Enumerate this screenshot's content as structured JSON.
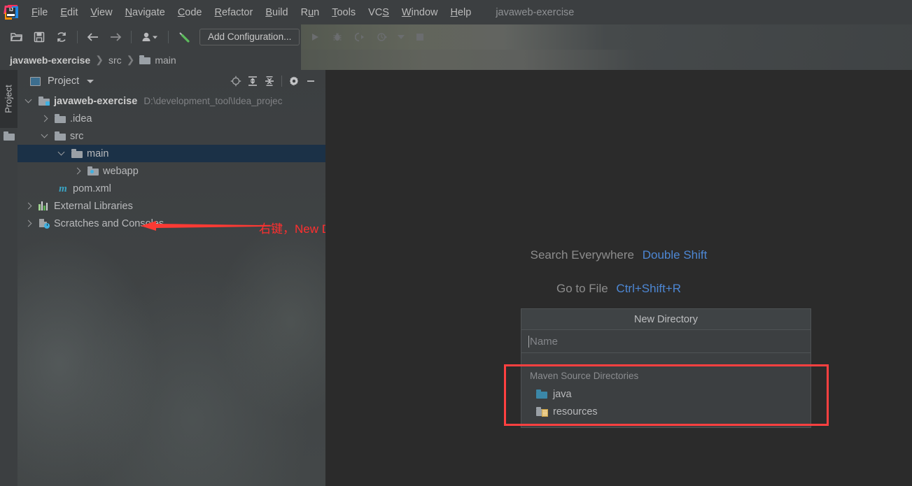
{
  "window": {
    "project_title": "javaweb-exercise"
  },
  "menubar": {
    "items": [
      {
        "label": "File",
        "mnemonic": "F"
      },
      {
        "label": "Edit",
        "mnemonic": "E"
      },
      {
        "label": "View",
        "mnemonic": "V"
      },
      {
        "label": "Navigate",
        "mnemonic": "N"
      },
      {
        "label": "Code",
        "mnemonic": "C"
      },
      {
        "label": "Refactor",
        "mnemonic": "R"
      },
      {
        "label": "Build",
        "mnemonic": "B"
      },
      {
        "label": "Run",
        "mnemonic": "u"
      },
      {
        "label": "Tools",
        "mnemonic": "T"
      },
      {
        "label": "VCS",
        "mnemonic": "S"
      },
      {
        "label": "Window",
        "mnemonic": "W"
      },
      {
        "label": "Help",
        "mnemonic": "H"
      }
    ]
  },
  "toolbar": {
    "add_configuration": "Add Configuration...",
    "icons": [
      "open-folder-icon",
      "save-all-icon",
      "sync-refresh-icon",
      "back-arrow-icon",
      "forward-arrow-icon",
      "user-dropdown-icon",
      "build-hammer-icon",
      "run-icon",
      "debug-icon",
      "run-coverage-icon",
      "profiler-icon",
      "dropdown-caret-icon",
      "stop-icon"
    ]
  },
  "breadcrumb": {
    "root": "javaweb-exercise",
    "parts": [
      "src",
      "main"
    ]
  },
  "left_strip": {
    "project_tab_label": "Project"
  },
  "project_panel": {
    "title": "Project",
    "tool_icons": [
      "locate-target-icon",
      "expand-all-icon",
      "collapse-all-icon",
      "settings-gear-icon",
      "hide-minimize-icon"
    ],
    "tree": [
      {
        "label": "javaweb-exercise",
        "path": "D:\\development_tool\\Idea_projec",
        "icon": "module-folder-icon",
        "indent": 0,
        "expanded": true,
        "bold": true,
        "selected": false
      },
      {
        "label": ".idea",
        "path": "",
        "icon": "folder-icon",
        "indent": 1,
        "expanded": false,
        "bold": false,
        "selected": false
      },
      {
        "label": "src",
        "path": "",
        "icon": "folder-icon",
        "indent": 1,
        "expanded": true,
        "bold": false,
        "selected": false
      },
      {
        "label": "main",
        "path": "",
        "icon": "folder-icon",
        "indent": 2,
        "expanded": true,
        "bold": false,
        "selected": true
      },
      {
        "label": "webapp",
        "path": "",
        "icon": "webapp-folder-icon",
        "indent": 3,
        "expanded": false,
        "bold": false,
        "selected": false
      },
      {
        "label": "pom.xml",
        "path": "",
        "icon": "maven-m-icon",
        "indent": 2,
        "expanded": null,
        "bold": false,
        "selected": false
      },
      {
        "label": "External Libraries",
        "path": "",
        "icon": "libraries-icon",
        "indent": 0,
        "expanded": false,
        "bold": false,
        "selected": false
      },
      {
        "label": "Scratches and Consoles",
        "path": "",
        "icon": "scratches-icon",
        "indent": 0,
        "expanded": false,
        "bold": false,
        "selected": false
      }
    ]
  },
  "annotations": {
    "arrow_note": "右键，New Directoyr",
    "arrow_color": "#ff2f2f",
    "highlight_color": "#ff4040"
  },
  "editor_hints": [
    {
      "name": "Search Everywhere",
      "key": "Double Shift"
    },
    {
      "name": "Go to File",
      "key": "Ctrl+Shift+R"
    }
  ],
  "new_directory_popup": {
    "title": "New Directory",
    "name_placeholder": "Name",
    "name_value": "",
    "section_title": "Maven Source Directories",
    "items": [
      {
        "label": "java",
        "icon": "source-folder-icon"
      },
      {
        "label": "resources",
        "icon": "resources-folder-icon"
      }
    ]
  }
}
